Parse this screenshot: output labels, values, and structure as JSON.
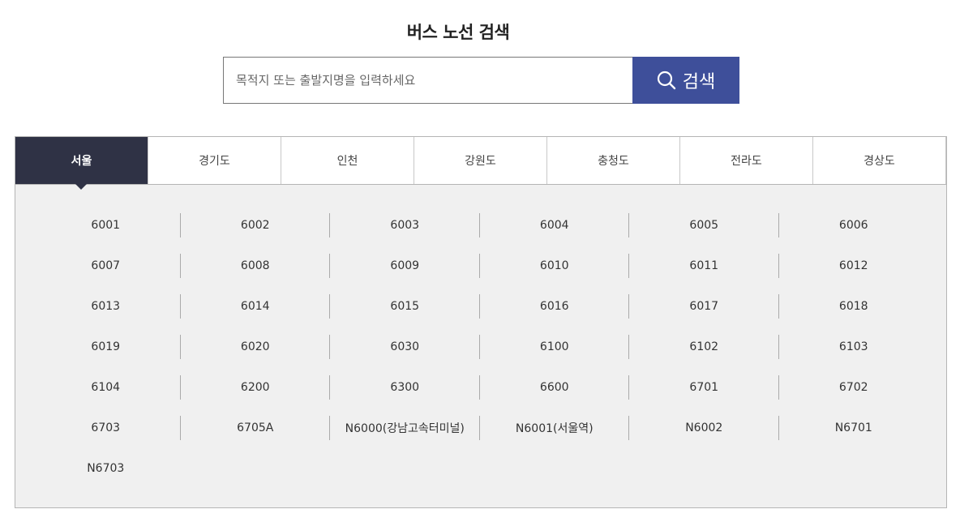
{
  "page": {
    "title": "버스 노선 검색"
  },
  "search": {
    "placeholder": "목적지 또는 출발지명을 입력하세요",
    "value": "",
    "button_label": "검색",
    "button_icon": "search-icon"
  },
  "regions": {
    "active_index": 0,
    "tabs": [
      "서울",
      "경기도",
      "인천",
      "강원도",
      "충청도",
      "전라도",
      "경상도"
    ]
  },
  "routes": [
    "6001",
    "6002",
    "6003",
    "6004",
    "6005",
    "6006",
    "6007",
    "6008",
    "6009",
    "6010",
    "6011",
    "6012",
    "6013",
    "6014",
    "6015",
    "6016",
    "6017",
    "6018",
    "6019",
    "6020",
    "6030",
    "6100",
    "6102",
    "6103",
    "6104",
    "6200",
    "6300",
    "6600",
    "6701",
    "6702",
    "6703",
    "6705A",
    "N6000(강남고속터미널)",
    "N6001(서울역)",
    "N6002",
    "N6701",
    "N6703"
  ],
  "colors": {
    "accent": "#3e4f9a",
    "active_tab": "#2f3245",
    "panel_bg": "#f0f0f0"
  }
}
